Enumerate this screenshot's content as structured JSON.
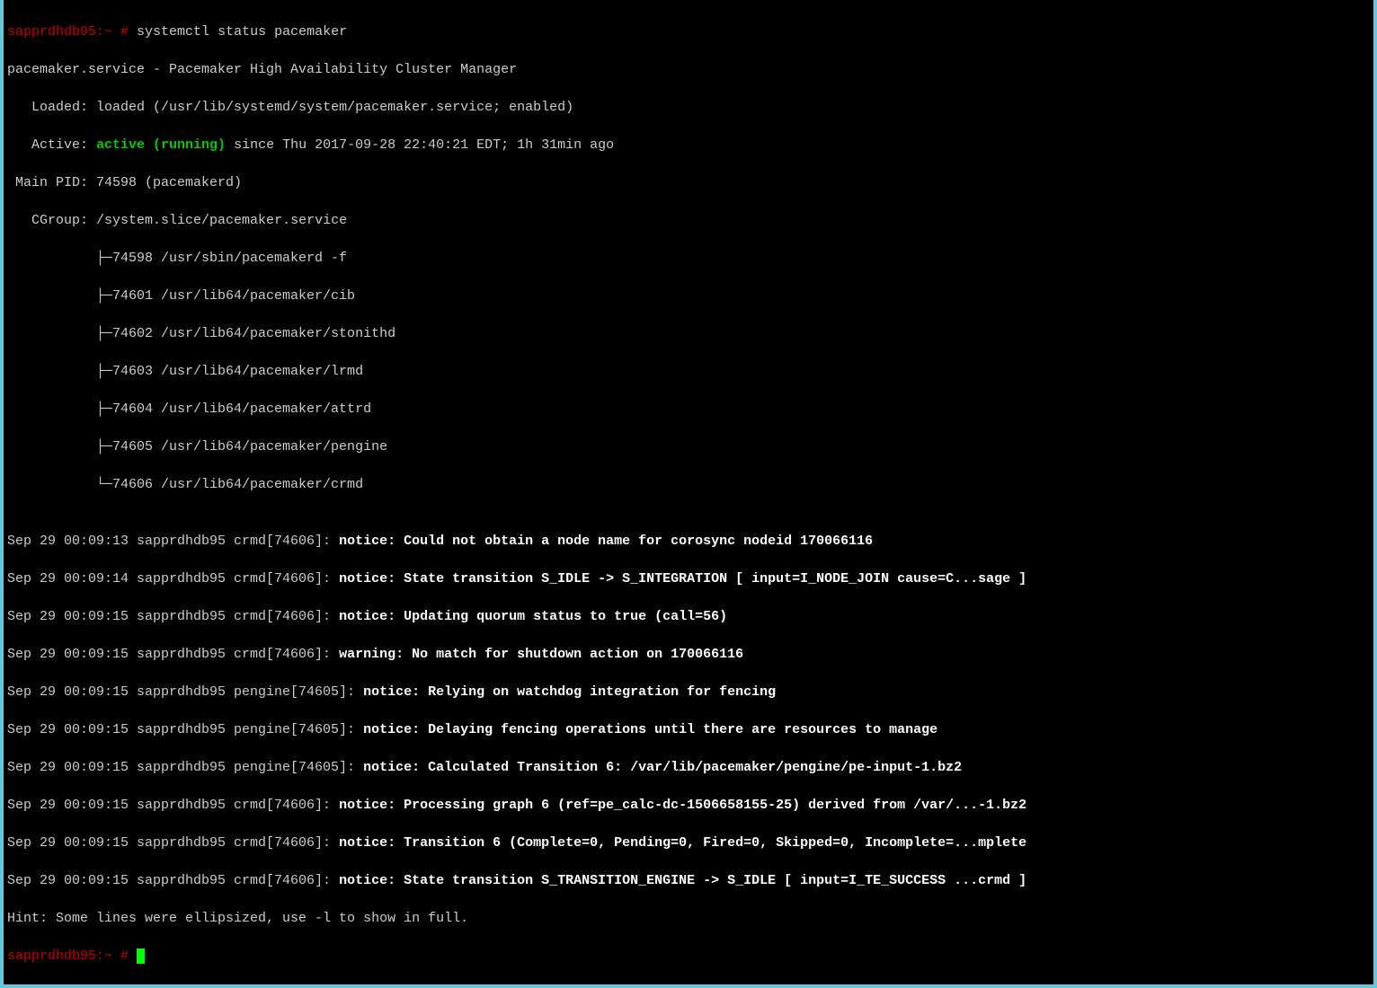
{
  "prompt": {
    "host": "sapprdhdb95:~",
    "hash": " #",
    "command": " systemctl status pacemaker"
  },
  "status": {
    "unit_line": "pacemaker.service - Pacemaker High Availability Cluster Manager",
    "loaded_label": "   Loaded: ",
    "loaded_value": "loaded (/usr/lib/systemd/system/pacemaker.service; enabled)",
    "active_label": "   Active: ",
    "active_value": "active (running)",
    "active_since": " since Thu 2017-09-28 22:40:21 EDT; 1h 31min ago",
    "mainpid_label": " Main PID: ",
    "mainpid_value": "74598 (pacemakerd)",
    "cgroup_label": "   CGroup: ",
    "cgroup_value": "/system.slice/pacemaker.service"
  },
  "tree": {
    "l1": "           ├─74598 /usr/sbin/pacemakerd -f",
    "l2": "           ├─74601 /usr/lib64/pacemaker/cib",
    "l3": "           ├─74602 /usr/lib64/pacemaker/stonithd",
    "l4": "           ├─74603 /usr/lib64/pacemaker/lrmd",
    "l5": "           ├─74604 /usr/lib64/pacemaker/attrd",
    "l6": "           ├─74605 /usr/lib64/pacemaker/pengine",
    "l7": "           └─74606 /usr/lib64/pacemaker/crmd"
  },
  "blank": "",
  "logs": {
    "r1p": "Sep 29 00:09:13 sapprdhdb95 crmd[74606]: ",
    "r1m": "notice: Could not obtain a node name for corosync nodeid 170066116",
    "r2p": "Sep 29 00:09:14 sapprdhdb95 crmd[74606]: ",
    "r2m": "notice: State transition S_IDLE -> S_INTEGRATION [ input=I_NODE_JOIN cause=C...sage ]",
    "r3p": "Sep 29 00:09:15 sapprdhdb95 crmd[74606]: ",
    "r3m": "notice: Updating quorum status to true (call=56)",
    "r4p": "Sep 29 00:09:15 sapprdhdb95 crmd[74606]: ",
    "r4m": "warning: No match for shutdown action on 170066116",
    "r5p": "Sep 29 00:09:15 sapprdhdb95 pengine[74605]: ",
    "r5m": "notice: Relying on watchdog integration for fencing",
    "r6p": "Sep 29 00:09:15 sapprdhdb95 pengine[74605]: ",
    "r6m": "notice: Delaying fencing operations until there are resources to manage",
    "r7p": "Sep 29 00:09:15 sapprdhdb95 pengine[74605]: ",
    "r7m": "notice: Calculated Transition 6: /var/lib/pacemaker/pengine/pe-input-1.bz2",
    "r8p": "Sep 29 00:09:15 sapprdhdb95 crmd[74606]: ",
    "r8m": "notice: Processing graph 6 (ref=pe_calc-dc-1506658155-25) derived from /var/...-1.bz2",
    "r9p": "Sep 29 00:09:15 sapprdhdb95 crmd[74606]: ",
    "r9m": "notice: Transition 6 (Complete=0, Pending=0, Fired=0, Skipped=0, Incomplete=...mplete",
    "r10p": "Sep 29 00:09:15 sapprdhdb95 crmd[74606]: ",
    "r10m": "notice: State transition S_TRANSITION_ENGINE -> S_IDLE [ input=I_TE_SUCCESS ...crmd ]"
  },
  "hint": "Hint: Some lines were ellipsized, use -l to show in full.",
  "prompt2": {
    "host": "sapprdhdb95:~",
    "hash": " # "
  }
}
